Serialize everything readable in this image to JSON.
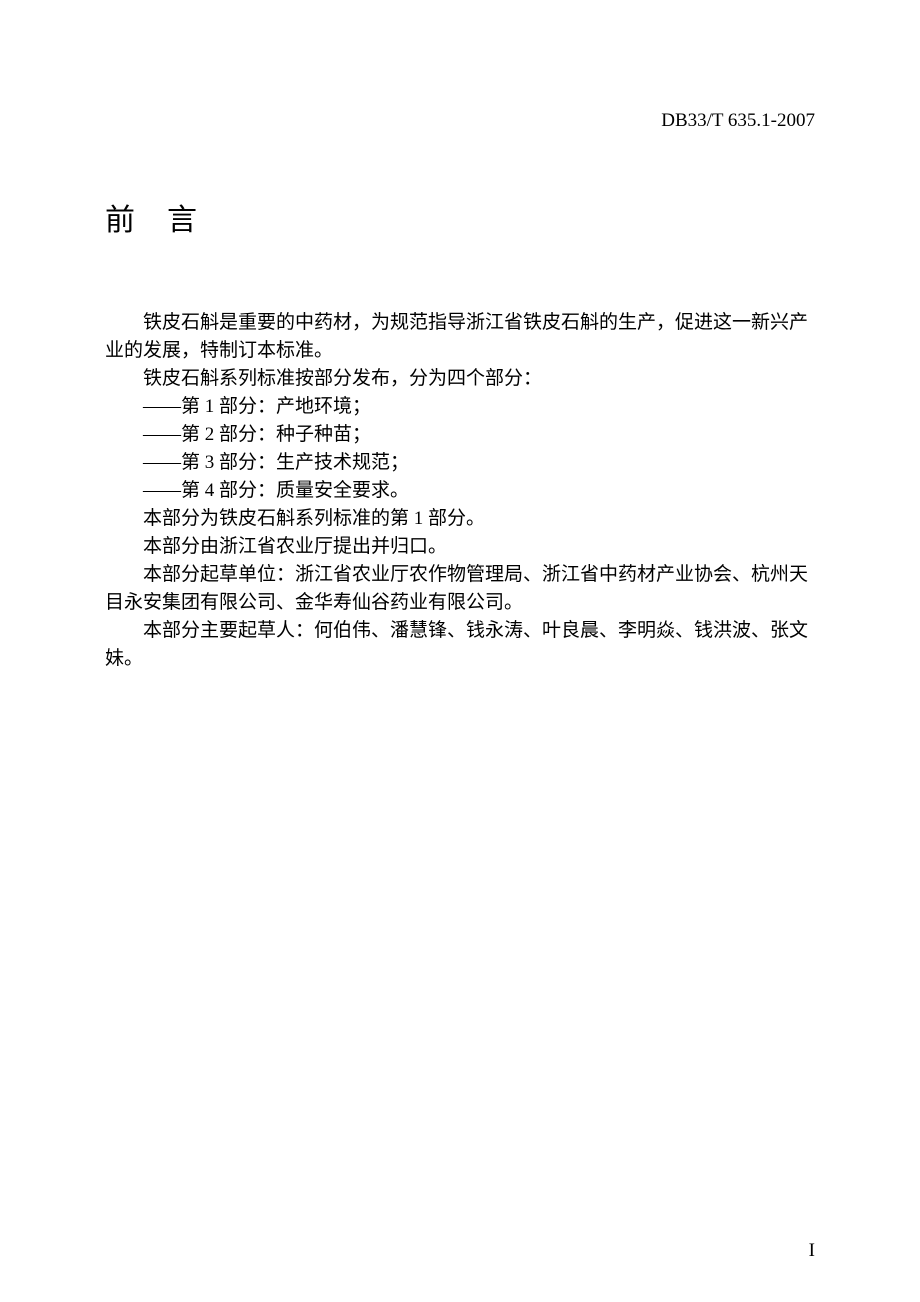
{
  "header": {
    "doc_number": "DB33/T 635.1-2007"
  },
  "title": "前言",
  "paragraphs": {
    "p1": "铁皮石斛是重要的中药材，为规范指导浙江省铁皮石斛的生产，促进这一新兴产业的发展，特制订本标准。",
    "p2": "铁皮石斛系列标准按部分发布，分为四个部分：",
    "p3": "——第 1 部分：产地环境；",
    "p4": "——第 2 部分：种子种苗；",
    "p5": "——第 3 部分：生产技术规范；",
    "p6": "——第 4 部分：质量安全要求。",
    "p7": "本部分为铁皮石斛系列标准的第 1 部分。",
    "p8": "本部分由浙江省农业厅提出并归口。",
    "p9": "本部分起草单位：浙江省农业厅农作物管理局、浙江省中药材产业协会、杭州天目永安集团有限公司、金华寿仙谷药业有限公司。",
    "p10": "本部分主要起草人：何伯伟、潘慧锋、钱永涛、叶良晨、李明焱、钱洪波、张文妹。"
  },
  "footer": {
    "page_number": "I"
  }
}
